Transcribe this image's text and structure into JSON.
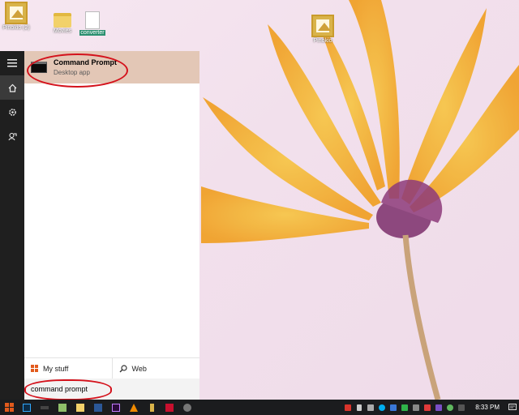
{
  "desktop": {
    "icons": [
      {
        "label": "Pinokio (2)"
      },
      {
        "label": "Movies"
      },
      {
        "label": "converter"
      },
      {
        "label": "Pinokio"
      }
    ]
  },
  "start_menu": {
    "best_match": {
      "title": "Command Prompt",
      "subtitle": "Desktop app"
    },
    "filters": {
      "my_stuff": "My stuff",
      "web": "Web"
    },
    "search": {
      "value": "command prompt"
    }
  },
  "taskbar": {
    "clock": "8:33 PM"
  },
  "colors": {
    "highlight": "#e3c7b6",
    "annotation": "#d4121c",
    "taskbar": "#1b1c1e"
  }
}
